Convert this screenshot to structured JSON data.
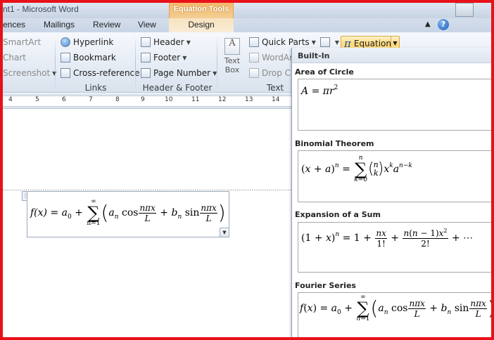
{
  "window": {
    "title": "nt1 - Microsoft Word",
    "contextual_tab_group": "Equation Tools"
  },
  "tabs": [
    {
      "label": "ences"
    },
    {
      "label": "Mailings"
    },
    {
      "label": "Review"
    },
    {
      "label": "View"
    },
    {
      "label": "Design"
    }
  ],
  "ribbon": {
    "illustrations": {
      "smartart": "SmartArt",
      "chart": "Chart",
      "screenshot": "Screenshot"
    },
    "links": {
      "label": "Links",
      "hyperlink": "Hyperlink",
      "bookmark": "Bookmark",
      "cross_reference": "Cross-reference"
    },
    "header_footer": {
      "label": "Header & Footer",
      "header": "Header",
      "footer": "Footer",
      "page_number": "Page Number"
    },
    "text": {
      "label": "Text",
      "text_box": "Text Box",
      "quick_parts": "Quick Parts",
      "wordart": "WordArt",
      "drop_cap": "Drop Ca"
    },
    "equation_button": "Equation"
  },
  "ruler": {
    "numbers": [
      "4",
      "5",
      "6",
      "7",
      "8",
      "9",
      "10",
      "11",
      "12",
      "13",
      "14"
    ]
  },
  "document": {
    "equation": {
      "lhs": "f(x) = a",
      "sub0": "0",
      "plus": "+",
      "sum_upper": "∞",
      "sum_symbol": "∑",
      "sum_lower": "n=1",
      "a": "a",
      "n": "n",
      "cos": "cos",
      "frac_num": "nπx",
      "frac_den": "L",
      "b": "b",
      "sin": "sin"
    }
  },
  "gallery": {
    "header": "Built-In",
    "items": [
      {
        "name": "Area of Circle"
      },
      {
        "name": "Binomial Theorem"
      },
      {
        "name": "Expansion of a Sum"
      },
      {
        "name": "Fourier Series"
      }
    ]
  },
  "colors": {
    "border_red": "#e8111a",
    "equation_highlight": "#ffd778",
    "contextual_orange": "#f6b86a"
  }
}
